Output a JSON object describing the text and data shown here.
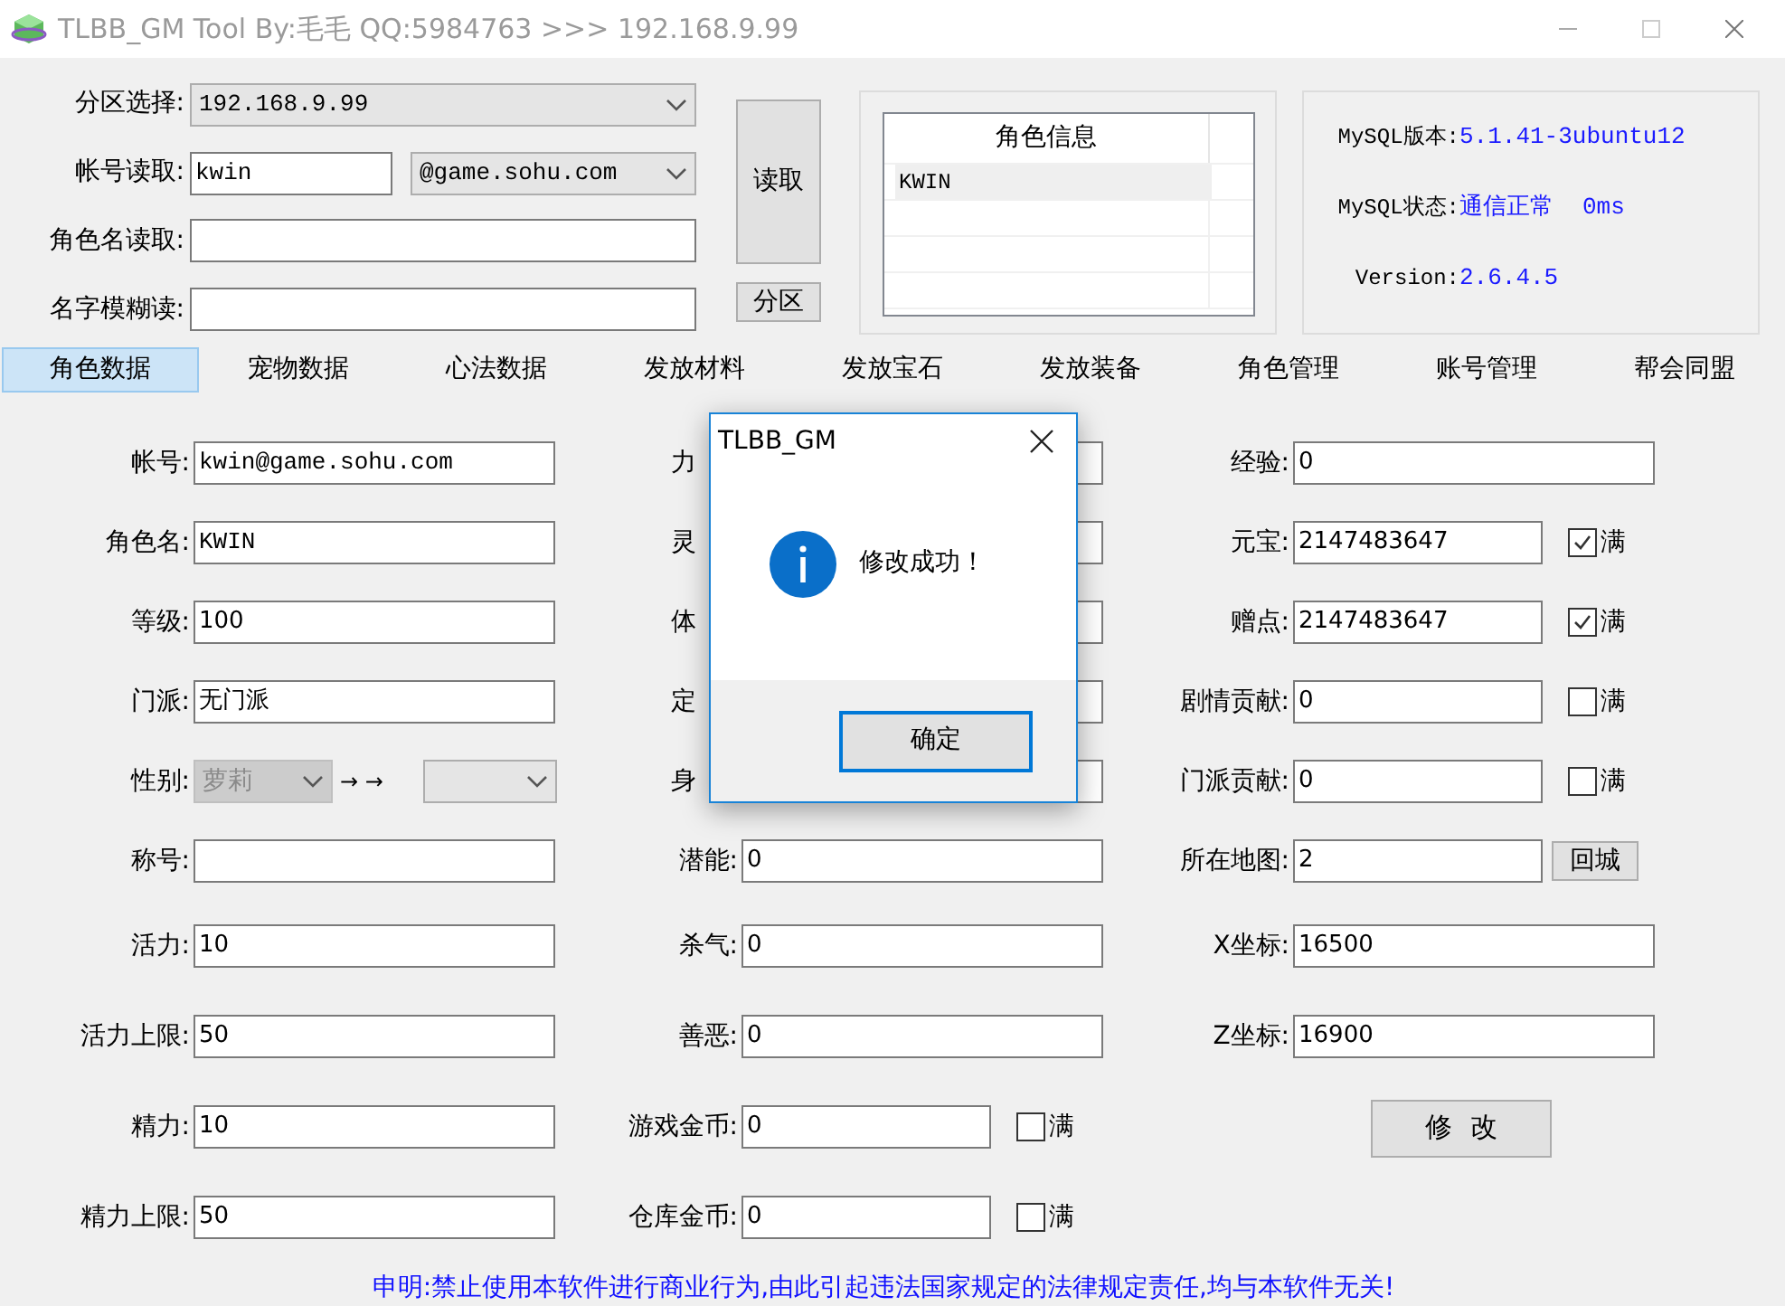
{
  "window": {
    "title": "TLBB_GM Tool By:毛毛 QQ:5984763 >>> 192.168.9.99"
  },
  "server": {
    "rows": [
      {
        "kind": "select",
        "label": "分区选择:",
        "value": "192.168.9.99"
      },
      {
        "kind": "account",
        "label": "帐号读取:",
        "value": "kwin",
        "domain": "@game.sohu.com"
      },
      {
        "kind": "input",
        "label": "角色名读取:"
      },
      {
        "kind": "input",
        "label": "名字模糊读:"
      }
    ],
    "read_button": "读取",
    "zone_button": "分区"
  },
  "role_info": {
    "header": "角色信息",
    "rows": [
      "KWIN"
    ]
  },
  "mysql": [
    {
      "label": "MySQL版本:",
      "value": "5.1.41-3ubuntu12"
    },
    {
      "label": "MySQL状态:",
      "value": "通信正常",
      "extra": "0ms"
    },
    {
      "label": "Version:",
      "value": "2.6.4.5"
    }
  ],
  "tabs": [
    {
      "label": "角色数据",
      "selected": true
    },
    {
      "label": "宠物数据",
      "selected": false
    },
    {
      "label": "心法数据",
      "selected": false
    },
    {
      "label": "发放材料",
      "selected": false
    },
    {
      "label": "发放宝石",
      "selected": false
    },
    {
      "label": "发放装备",
      "selected": false
    },
    {
      "label": "角色管理",
      "selected": false
    },
    {
      "label": "账号管理",
      "selected": false
    },
    {
      "label": "帮会同盟",
      "selected": false
    }
  ],
  "form": {
    "rows": [
      [
        {
          "kind": "field",
          "label": "帐号:",
          "value": "kwin@game.sohu.com"
        },
        {
          "kind": "covered",
          "label": "力"
        },
        {
          "kind": "field",
          "label": "经验:",
          "value": "0"
        }
      ],
      [
        {
          "kind": "field",
          "label": "角色名:",
          "value": "KWIN"
        },
        {
          "kind": "covered",
          "label": "灵"
        },
        {
          "kind": "field_check",
          "label": "元宝:",
          "value": "2147483647",
          "check": "满",
          "checked": true
        }
      ],
      [
        {
          "kind": "field",
          "label": "等级:",
          "value": "100"
        },
        {
          "kind": "covered",
          "label": "体"
        },
        {
          "kind": "field_check",
          "label": "赠点:",
          "value": "2147483647",
          "check": "满",
          "checked": true
        }
      ],
      [
        {
          "kind": "field",
          "label": "门派:",
          "value": "无门派"
        },
        {
          "kind": "covered",
          "label": "定"
        },
        {
          "kind": "field_check",
          "label": "剧情贡献:",
          "value": "0",
          "check": "满",
          "checked": false
        }
      ],
      [
        {
          "kind": "select_pair",
          "label": "性别:",
          "value": "萝莉",
          "disabled": true,
          "arrows": "→ →"
        },
        {
          "kind": "covered",
          "label": "身"
        },
        {
          "kind": "field_check",
          "label": "门派贡献:",
          "value": "0",
          "check": "满",
          "checked": false
        }
      ],
      [
        {
          "kind": "field",
          "label": "称号:"
        },
        {
          "kind": "field",
          "label": "潜能:",
          "value": "0"
        },
        {
          "kind": "field_button",
          "label": "所在地图:",
          "value": "2",
          "button": "回城"
        }
      ],
      [
        {
          "kind": "field",
          "label": "活力:",
          "value": "10"
        },
        {
          "kind": "field",
          "label": "杀气:",
          "value": "0"
        },
        {
          "kind": "field",
          "label": "X坐标:",
          "value": "16500"
        }
      ],
      [
        {
          "kind": "field",
          "label": "活力上限:",
          "value": "50"
        },
        {
          "kind": "field",
          "label": "善恶:",
          "value": "0"
        },
        {
          "kind": "field",
          "label": "Z坐标:",
          "value": "16900"
        }
      ],
      [
        {
          "kind": "field",
          "label": "精力:",
          "value": "10"
        },
        {
          "kind": "field_check",
          "label": "游戏金币:",
          "value": "0",
          "check": "满",
          "checked": false
        },
        {
          "kind": "button",
          "label": "修  改"
        }
      ],
      [
        {
          "kind": "field",
          "label": "精力上限:",
          "value": "50"
        },
        {
          "kind": "field_check",
          "label": "仓库金币:",
          "value": "0",
          "check": "满",
          "checked": false
        },
        {
          "kind": "empty"
        }
      ]
    ]
  },
  "notice": "申明:禁止使用本软件进行商业行为,由此引起违法国家规定的法律规定责任,均与本软件无关!",
  "dialog": {
    "title": "TLBB_GM",
    "message": "修改成功！",
    "button": "确定"
  }
}
